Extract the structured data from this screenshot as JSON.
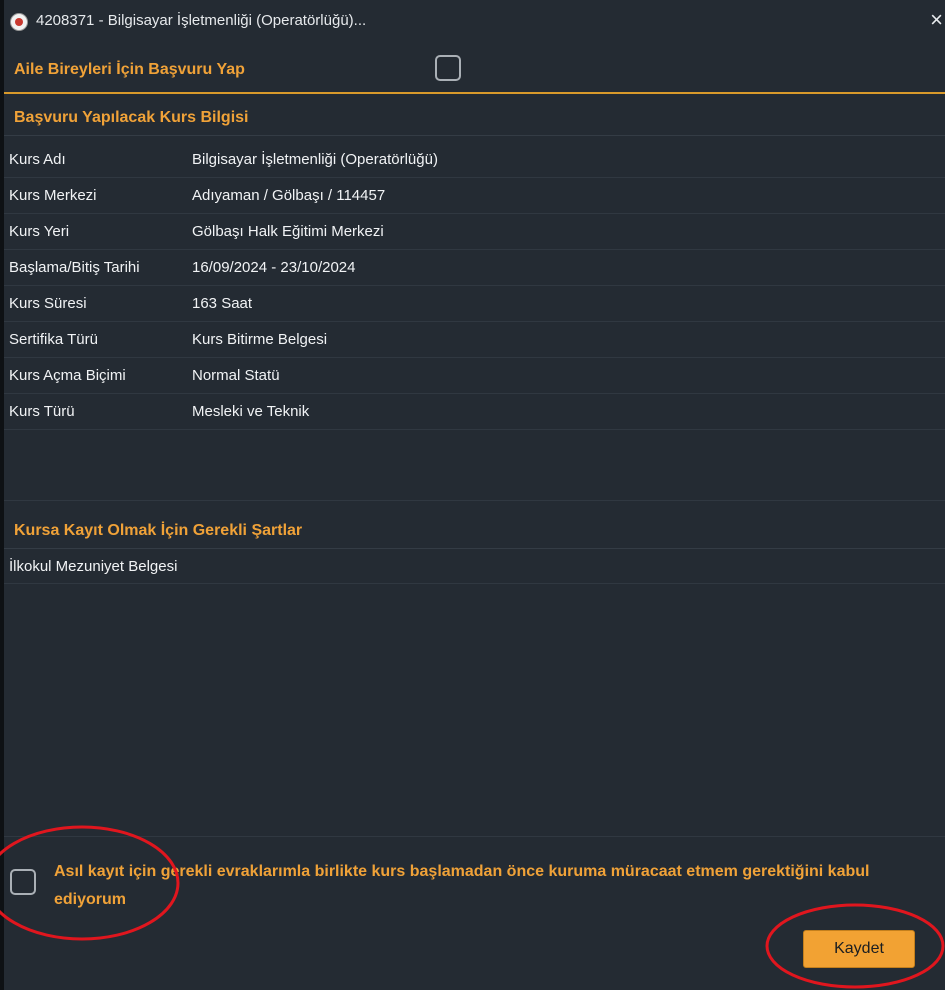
{
  "window": {
    "title": "4208371 - Bilgisayar İşletmenliği (Operatörlüğü)...",
    "close_glyph": "×"
  },
  "family": {
    "label": "Aile Bireyleri İçin Başvuru Yap",
    "checked": false
  },
  "course_info": {
    "heading": "Başvuru Yapılacak Kurs Bilgisi",
    "rows": [
      {
        "key": "Kurs Adı",
        "value": "Bilgisayar İşletmenliği (Operatörlüğü)"
      },
      {
        "key": "Kurs Merkezi",
        "value": "Adıyaman / Gölbaşı / 114457"
      },
      {
        "key": "Kurs Yeri",
        "value": "Gölbaşı Halk Eğitimi Merkezi"
      },
      {
        "key": "Başlama/Bitiş Tarihi",
        "value": "16/09/2024 - 23/10/2024"
      },
      {
        "key": "Kurs Süresi",
        "value": "163 Saat"
      },
      {
        "key": "Sertifika Türü",
        "value": "Kurs Bitirme Belgesi"
      },
      {
        "key": "Kurs Açma Biçimi",
        "value": "Normal Statü"
      },
      {
        "key": "Kurs Türü",
        "value": "Mesleki ve Teknik"
      }
    ]
  },
  "requirements": {
    "heading": "Kursa Kayıt Olmak İçin Gerekli Şartlar",
    "items": [
      "İlkokul Mezuniyet Belgesi"
    ]
  },
  "agreement": {
    "text": "Asıl kayıt için gerekli evraklarımla birlikte kurs başlamadan önce kuruma müracaat etmem gerektiğini kabul ediyorum",
    "checked": false
  },
  "actions": {
    "save_label": "Kaydet"
  },
  "colors": {
    "background": "#242b33",
    "accent": "#f0a238",
    "annotation": "#e0161e"
  }
}
